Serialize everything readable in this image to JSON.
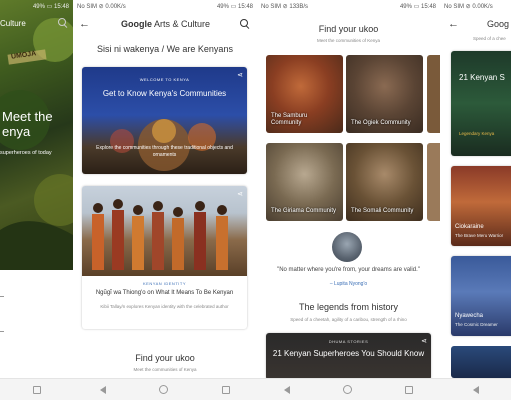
{
  "statusbars": {
    "p1": {
      "left": "",
      "right": "49% ▭ 15:48"
    },
    "p2": {
      "left": "No SIM ⊘ 0.00K/s",
      "right": "49% ▭ 15:48"
    },
    "p3": {
      "left": "No SIM ⊘ 133B/s",
      "right": "49% ▭ 15:48"
    },
    "p4": {
      "left": "No SIM ⊘ 0.00K/s",
      "right": ""
    }
  },
  "panel1": {
    "appbar_title_fragment": "Culture",
    "badge": "UMOJA",
    "hero_title_line1": "Meet the",
    "hero_title_line2": "enya",
    "hero_subtitle": "superheroes of today"
  },
  "panel2": {
    "app_title_bold": "Google",
    "app_title_rest": " Arts & Culture",
    "heading": "Sisi ni wakenya / We are Kenyans",
    "card1": {
      "kicker": "WELCOME TO KENYA",
      "title": "Get to Know Kenya's Communities",
      "desc": "Explore the communities through these traditional objects and ornaments"
    },
    "card2": {
      "kicker": "KENYAN IDENTITY",
      "title": "Ngũgĩ wa Thiong'o on What It Means To Be Kenyan",
      "desc": "Kibii Tallay/n explores Kenyan identity with the celebrated author"
    },
    "section_title": "Find your ukoo",
    "section_sub": "Meet the communities of Kenya"
  },
  "panel3": {
    "heading": "Find your ukoo",
    "sub": "Meet the communities of Kenya",
    "tiles": [
      {
        "label": "The Samburu Community"
      },
      {
        "label": "The Ogiek Community"
      },
      {
        "label": "The Giriama Community"
      },
      {
        "label": "The Somali Community"
      }
    ],
    "quote": "\"No matter where you're from, your dreams are valid.\"",
    "quote_author": "– Lupita Nyong'o",
    "legends_title": "The legends from history",
    "legends_sub": "Speed of a cheetah, agility of a caribou, strength of a rhino",
    "story_kicker": "DHUMA STORIES",
    "story_title": "21 Kenyan Superheroes You Should Know"
  },
  "panel4": {
    "appbar_title_fragment": "Goog",
    "sub": "Speed of a chee",
    "cards": [
      {
        "title": "21 Kenyan S",
        "sub": "Legendary Kenya"
      },
      {
        "title": "Ciokaraine",
        "sub": "The Brave Meru Warrior"
      },
      {
        "title": "Nyawecha",
        "sub": "The Cosmic Dreamer"
      }
    ]
  },
  "icons": [
    "search-icon",
    "back-arrow-icon",
    "share-icon",
    "nav-back-icon",
    "nav-home-icon",
    "nav-recent-icon"
  ],
  "colors": {
    "link_blue": "#3b6fb6",
    "text_dark": "#333333",
    "text_muted": "#888888"
  }
}
